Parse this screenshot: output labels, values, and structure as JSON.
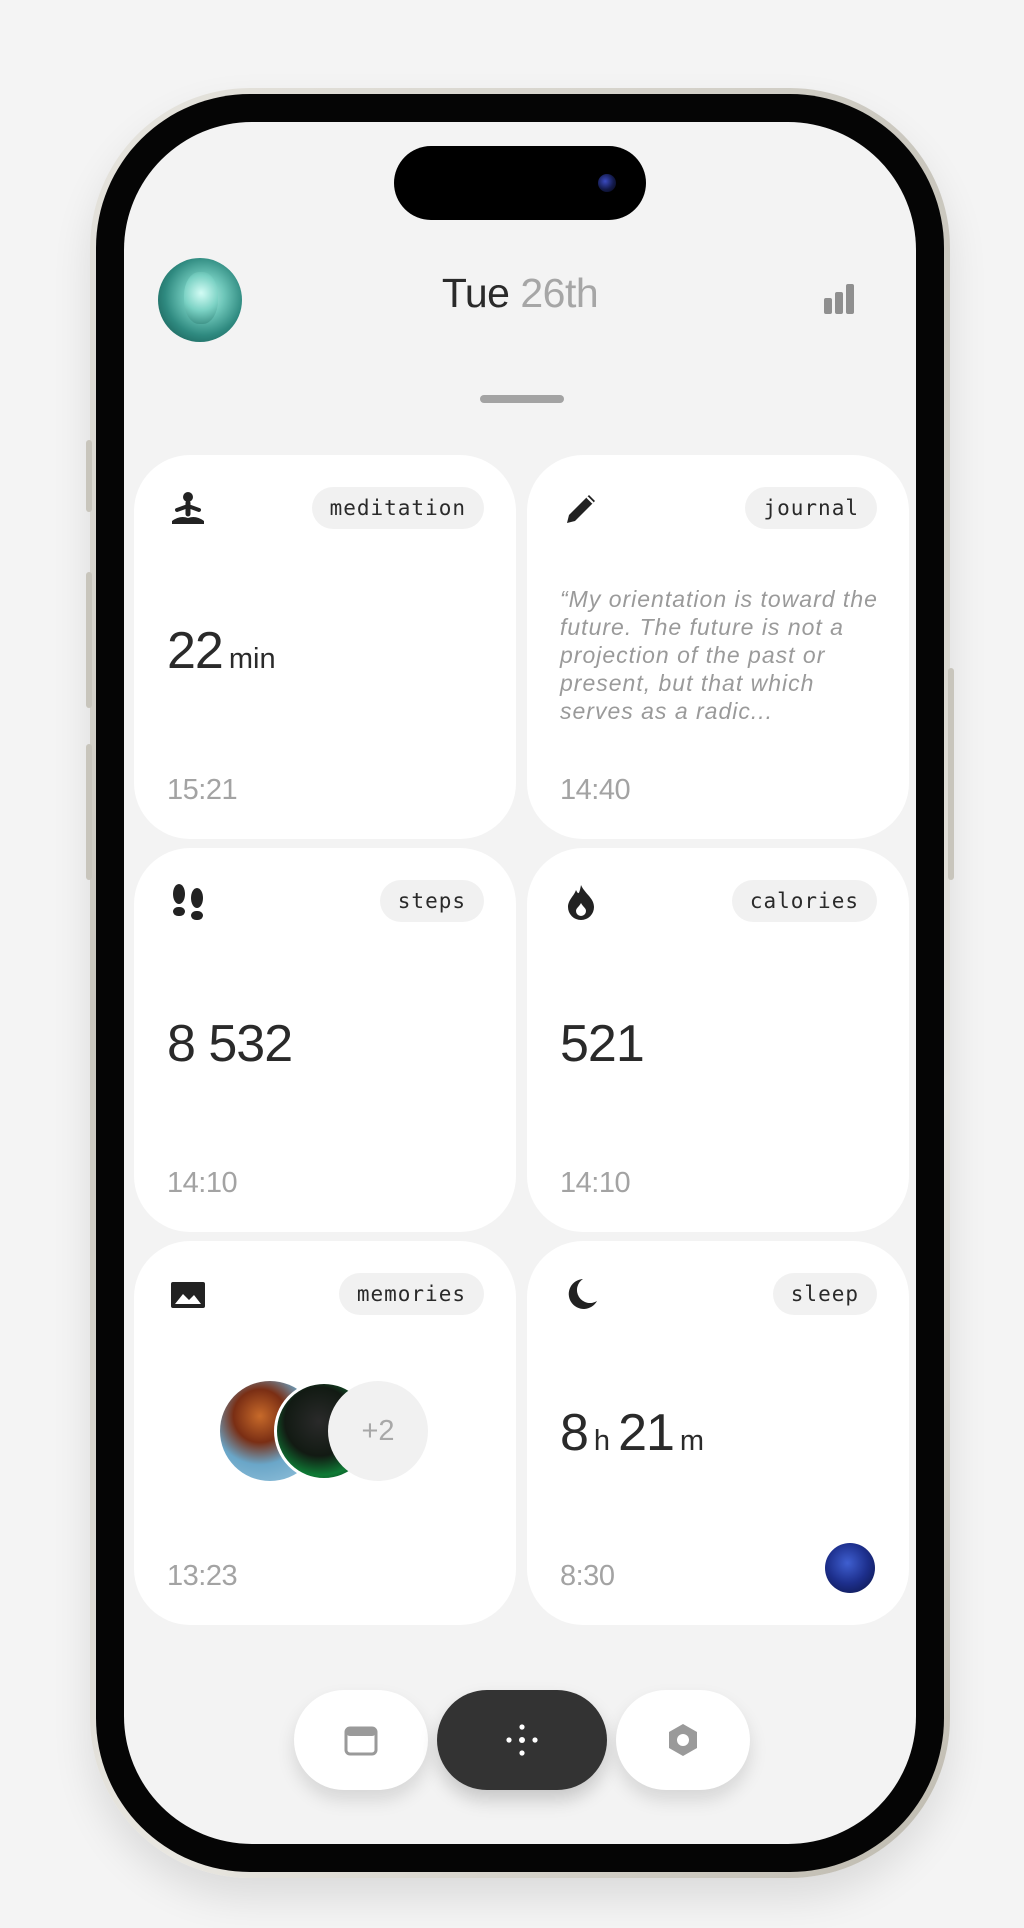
{
  "header": {
    "day": "Tue",
    "date": "26th"
  },
  "cards": [
    {
      "tag": "meditation",
      "value": "22",
      "unit": "min",
      "time": "15:21",
      "icon": "meditation-icon"
    },
    {
      "tag": "journal",
      "quote": "“My orientation is toward the future. The future is not a projection of the past or present, but that which serves as a radic...",
      "time": "14:40",
      "icon": "pencil-icon"
    },
    {
      "tag": "steps",
      "value": "8 532",
      "time": "14:10",
      "icon": "footprints-icon"
    },
    {
      "tag": "calories",
      "value": "521",
      "time": "14:10",
      "icon": "flame-icon"
    },
    {
      "tag": "memories",
      "more": "+2",
      "time": "13:23",
      "icon": "image-icon"
    },
    {
      "tag": "sleep",
      "hours": "8",
      "hours_unit": "h",
      "minutes": "21",
      "minutes_unit": "m",
      "time": "8:30",
      "icon": "moon-icon"
    }
  ],
  "nav": {
    "items": [
      "calendar-icon",
      "dots-icon",
      "settings-hex-icon"
    ]
  },
  "colors": {
    "background": "#f3f3f3",
    "card": "#ffffff",
    "text": "#2a2a2a",
    "muted": "#a3a3a3",
    "nav_active": "#333333"
  }
}
